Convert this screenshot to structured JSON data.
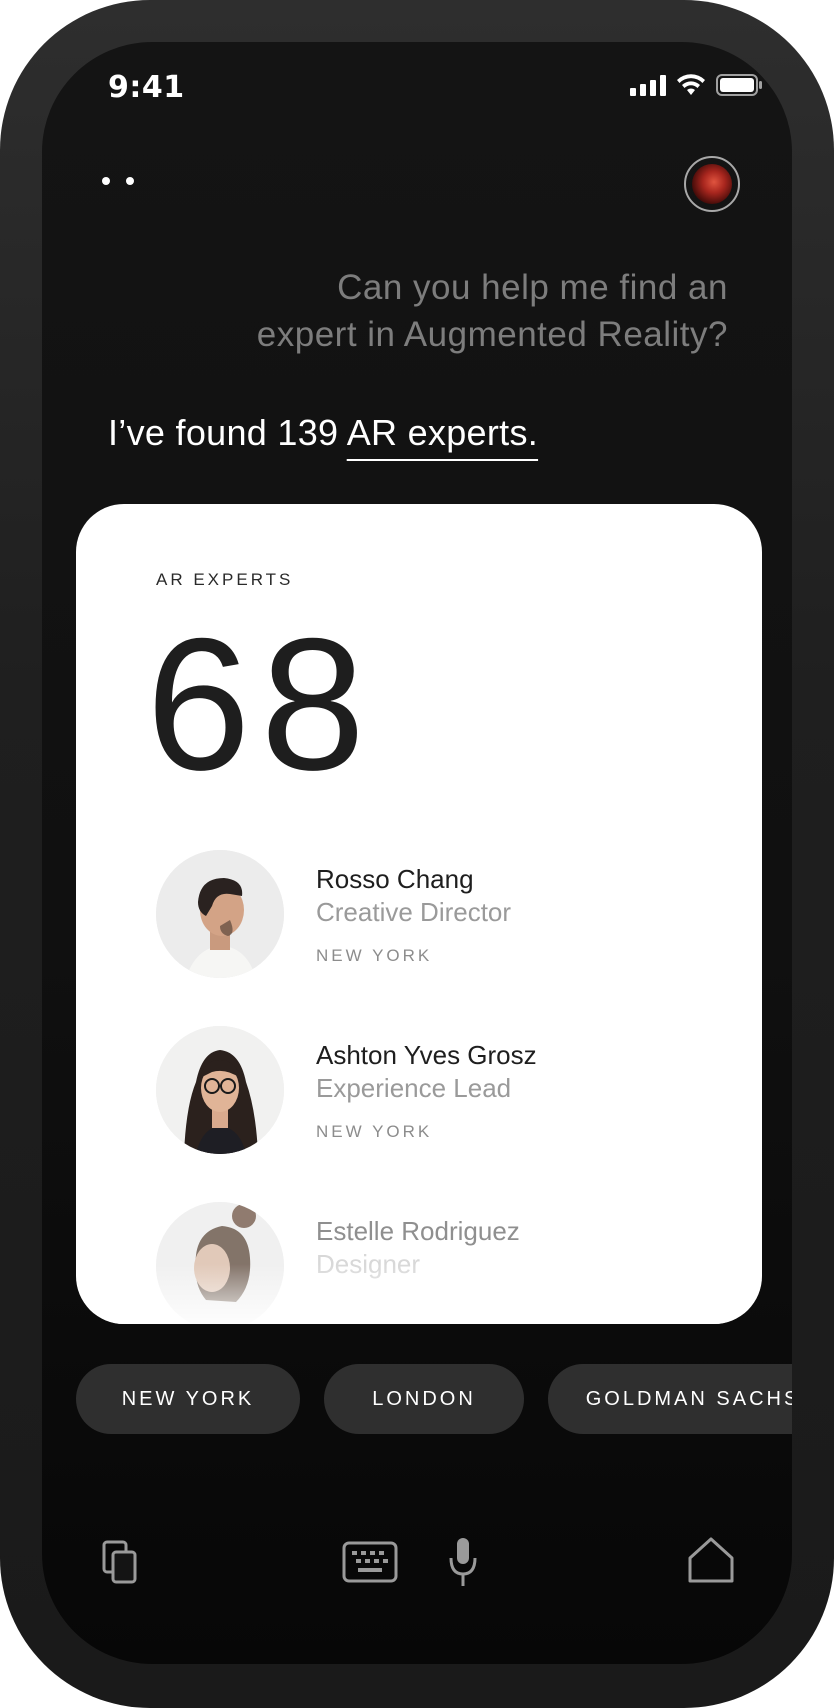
{
  "status_bar": {
    "time": "9:41"
  },
  "conversation": {
    "question_line1": "Can you help me find an",
    "question_line2": "expert in Augmented Reality?",
    "answer_prefix": "I’ve found 139 ",
    "answer_link": "AR experts."
  },
  "card": {
    "label": "AR EXPERTS",
    "count": "68",
    "people": [
      {
        "name": "Rosso Chang",
        "role": "Creative Director",
        "location": "NEW YORK"
      },
      {
        "name": "Ashton Yves Grosz",
        "role": "Experience Lead",
        "location": "NEW YORK"
      },
      {
        "name": "Estelle Rodriguez",
        "role": "Designer",
        "location": ""
      }
    ]
  },
  "filters": [
    "NEW YORK",
    "LONDON",
    "GOLDMAN SACHS"
  ],
  "toolbar": {
    "icons": [
      "cards-icon",
      "keyboard-icon",
      "microphone-icon",
      "home-icon"
    ]
  }
}
